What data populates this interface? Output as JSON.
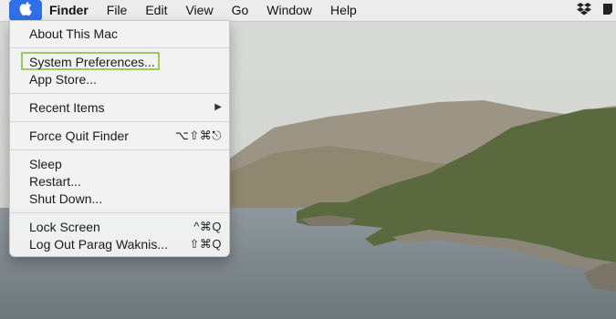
{
  "menubar": {
    "apple_icon": "apple-icon",
    "items": [
      "Finder",
      "File",
      "Edit",
      "View",
      "Go",
      "Window",
      "Help"
    ],
    "status_icons": [
      "dropbox-icon",
      "display-icon"
    ]
  },
  "apple_menu": {
    "items": [
      {
        "label": "About This Mac",
        "shortcut": ""
      },
      {
        "label": "System Preferences...",
        "shortcut": ""
      },
      {
        "label": "App Store...",
        "shortcut": ""
      },
      {
        "label": "Recent Items",
        "shortcut": "",
        "submenu": true
      },
      {
        "label": "Force Quit Finder",
        "shortcut": "⌥⇧⌘⎋"
      },
      {
        "label": "Sleep",
        "shortcut": ""
      },
      {
        "label": "Restart...",
        "shortcut": ""
      },
      {
        "label": "Shut Down...",
        "shortcut": ""
      },
      {
        "label": "Lock Screen",
        "shortcut": "^⌘Q"
      },
      {
        "label": "Log Out Parag Waknis...",
        "shortcut": "⇧⌘Q"
      }
    ],
    "highlighted": "System Preferences..."
  },
  "colors": {
    "accent": "#2f6fe8",
    "highlight_outline": "#9fc95a"
  }
}
